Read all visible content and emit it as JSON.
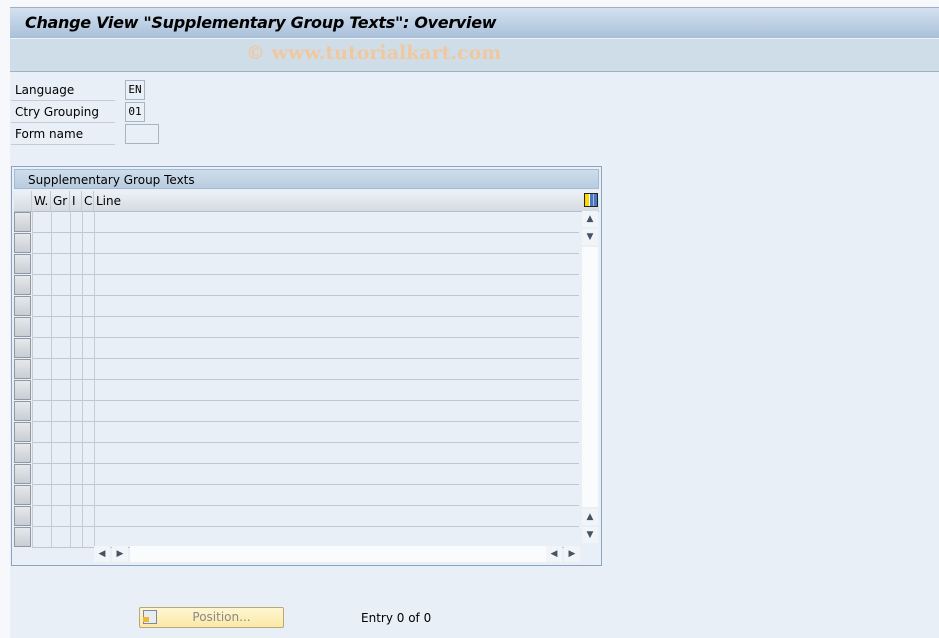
{
  "window": {
    "title": "Change View \"Supplementary Group Texts\": Overview",
    "watermark": "© www.tutorialkart.com"
  },
  "fields": [
    {
      "label": "Language",
      "value": "EN"
    },
    {
      "label": "Ctry Grouping",
      "value": "01"
    },
    {
      "label": "Form name",
      "value": ""
    }
  ],
  "table": {
    "title": "Supplementary Group Texts",
    "columns": [
      "W.",
      "Gr",
      "I",
      "C",
      "Line"
    ],
    "row_count_visible": 16,
    "rows": [],
    "column_config_icon": "table-settings-icon"
  },
  "footer": {
    "position_button": "Position...",
    "entry_text": "Entry 0 of 0"
  }
}
